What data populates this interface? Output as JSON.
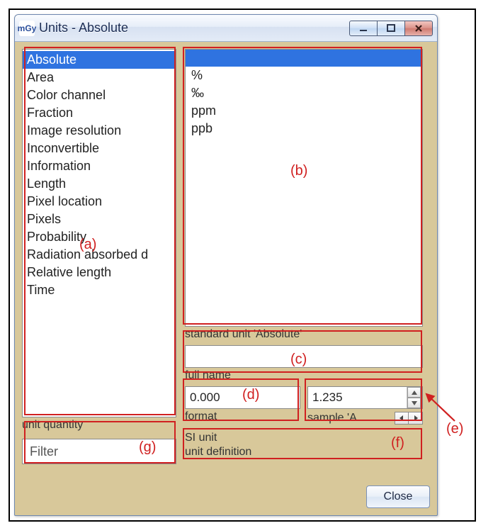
{
  "window": {
    "title": "Units - Absolute",
    "app_icon_text": "mGy",
    "controls": {
      "minimize": "minimize",
      "maximize": "maximize",
      "close": "close"
    }
  },
  "leftList": {
    "items": [
      "Absolute",
      "Area",
      "Color channel",
      "Fraction",
      "Image resolution",
      "Inconvertible",
      "Information",
      "Length",
      "Pixel location",
      "Pixels",
      "Probability",
      "Radiation absorbed d",
      "Relative length",
      "Time"
    ],
    "selectedIndex": 0,
    "caption": "unit quantity"
  },
  "filter": {
    "value": "Filter"
  },
  "rightList": {
    "items": [
      "",
      "%",
      "‰",
      "ppm",
      "ppb"
    ],
    "selectedIndex": 0,
    "caption": "standard unit 'Absolute'"
  },
  "fullName": {
    "label": "full name",
    "value": ""
  },
  "format": {
    "value": "0.000",
    "label": "format"
  },
  "sample": {
    "value": "1.235",
    "label": "sample 'A"
  },
  "siUnit": {
    "label": "SI unit",
    "value": ""
  },
  "unitDef": {
    "label": "unit definition"
  },
  "closeLabel": "Close",
  "annotations": {
    "a": "(a)",
    "b": "(b)",
    "c": "(c)",
    "d": "(d)",
    "e": "(e)",
    "f": "(f)",
    "g": "(g)"
  }
}
